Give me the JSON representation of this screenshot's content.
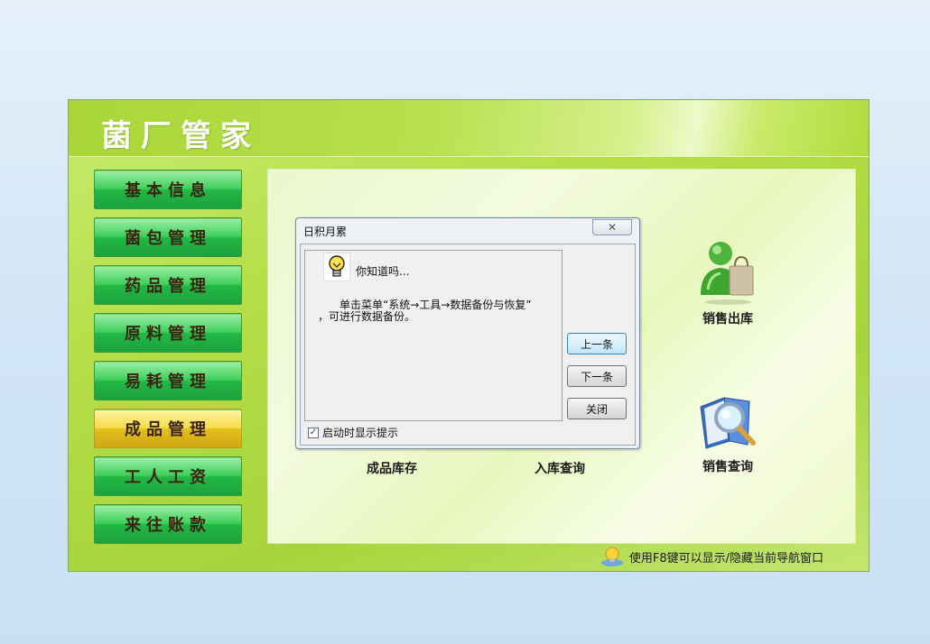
{
  "app": {
    "title": "菌厂管家",
    "accent_color": "#a6d43a"
  },
  "nav": {
    "items": [
      {
        "label": "基本信息",
        "active": false
      },
      {
        "label": "菌包管理",
        "active": false
      },
      {
        "label": "药品管理",
        "active": false
      },
      {
        "label": "原料管理",
        "active": false
      },
      {
        "label": "易耗管理",
        "active": false
      },
      {
        "label": "成品管理",
        "active": true
      },
      {
        "label": "工人工资",
        "active": false
      },
      {
        "label": "来往账款",
        "active": false
      }
    ]
  },
  "modules": {
    "sales_out": {
      "label": "销售出库",
      "icon": "user-shopping-bag-icon"
    },
    "product_stock": {
      "label": "成品库存",
      "icon": "stock-icon"
    },
    "inbound_query": {
      "label": "入库查询",
      "icon": "inbound-icon"
    },
    "sales_query": {
      "label": "销售查询",
      "icon": "magnifier-book-icon"
    }
  },
  "status_bar": {
    "text": "使用F8键可以显示/隐藏当前导航窗口",
    "icon": "info-bulb-icon"
  },
  "dialog": {
    "title": "日积月累",
    "close_label": "✕",
    "tip_heading": "你知道吗...",
    "tip_line1": "单击菜单“系统→工具→数据备份与恢复”",
    "tip_line2": "，可进行数据备份。",
    "buttons": {
      "prev": "上一条",
      "next": "下一条",
      "close": "关闭"
    },
    "checkbox_label": "启动时显示提示",
    "checkbox_checked": true
  }
}
